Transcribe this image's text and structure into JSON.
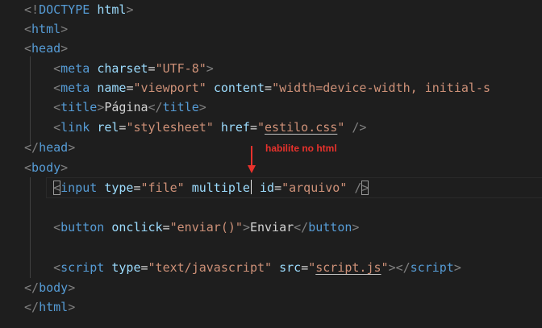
{
  "colors": {
    "bracket": "#808080",
    "tag": "#569cd6",
    "attr": "#9cdcfe",
    "string": "#ce9178",
    "text": "#d4d4d4",
    "annotation": "#e8322c"
  },
  "lines": [
    [
      {
        "t": "<!",
        "c": "bracket"
      },
      {
        "t": "DOCTYPE",
        "c": "tag"
      },
      {
        "t": " ",
        "c": "text"
      },
      {
        "t": "html",
        "c": "attr"
      },
      {
        "t": ">",
        "c": "bracket"
      }
    ],
    [
      {
        "t": "<",
        "c": "bracket"
      },
      {
        "t": "html",
        "c": "tag"
      },
      {
        "t": ">",
        "c": "bracket"
      }
    ],
    [
      {
        "t": "<",
        "c": "bracket"
      },
      {
        "t": "head",
        "c": "tag"
      },
      {
        "t": ">",
        "c": "bracket"
      }
    ],
    [
      {
        "t": "    ",
        "c": "text"
      },
      {
        "t": "<",
        "c": "bracket"
      },
      {
        "t": "meta",
        "c": "tag"
      },
      {
        "t": " ",
        "c": "text"
      },
      {
        "t": "charset",
        "c": "attr"
      },
      {
        "t": "=",
        "c": "text"
      },
      {
        "t": "\"UTF-8\"",
        "c": "string"
      },
      {
        "t": ">",
        "c": "bracket"
      }
    ],
    [
      {
        "t": "    ",
        "c": "text"
      },
      {
        "t": "<",
        "c": "bracket"
      },
      {
        "t": "meta",
        "c": "tag"
      },
      {
        "t": " ",
        "c": "text"
      },
      {
        "t": "name",
        "c": "attr"
      },
      {
        "t": "=",
        "c": "text"
      },
      {
        "t": "\"viewport\"",
        "c": "string"
      },
      {
        "t": " ",
        "c": "text"
      },
      {
        "t": "content",
        "c": "attr"
      },
      {
        "t": "=",
        "c": "text"
      },
      {
        "t": "\"width=device-width, initial-s",
        "c": "string"
      }
    ],
    [
      {
        "t": "    ",
        "c": "text"
      },
      {
        "t": "<",
        "c": "bracket"
      },
      {
        "t": "title",
        "c": "tag"
      },
      {
        "t": ">",
        "c": "bracket"
      },
      {
        "t": "Página",
        "c": "text"
      },
      {
        "t": "</",
        "c": "bracket"
      },
      {
        "t": "title",
        "c": "tag"
      },
      {
        "t": ">",
        "c": "bracket"
      }
    ],
    [
      {
        "t": "    ",
        "c": "text"
      },
      {
        "t": "<",
        "c": "bracket"
      },
      {
        "t": "link",
        "c": "tag"
      },
      {
        "t": " ",
        "c": "text"
      },
      {
        "t": "rel",
        "c": "attr"
      },
      {
        "t": "=",
        "c": "text"
      },
      {
        "t": "\"stylesheet\"",
        "c": "string"
      },
      {
        "t": " ",
        "c": "text"
      },
      {
        "t": "href",
        "c": "attr"
      },
      {
        "t": "=",
        "c": "text"
      },
      {
        "t": "\"",
        "c": "string"
      },
      {
        "t": "estilo.css",
        "c": "string",
        "u": true
      },
      {
        "t": "\"",
        "c": "string"
      },
      {
        "t": " ",
        "c": "text"
      },
      {
        "t": "/>",
        "c": "bracket"
      }
    ],
    [
      {
        "t": "</",
        "c": "bracket"
      },
      {
        "t": "head",
        "c": "tag"
      },
      {
        "t": ">",
        "c": "bracket"
      }
    ],
    [
      {
        "t": "<",
        "c": "bracket"
      },
      {
        "t": "body",
        "c": "tag"
      },
      {
        "t": ">",
        "c": "bracket"
      }
    ],
    [
      {
        "t": "    ",
        "c": "text"
      },
      {
        "t": "<",
        "c": "bracket",
        "box": true
      },
      {
        "t": "input",
        "c": "tag"
      },
      {
        "t": " ",
        "c": "text"
      },
      {
        "t": "type",
        "c": "attr"
      },
      {
        "t": "=",
        "c": "text"
      },
      {
        "t": "\"file\"",
        "c": "string"
      },
      {
        "t": " ",
        "c": "text"
      },
      {
        "t": "multiple",
        "c": "attr",
        "caret": true
      },
      {
        "t": " ",
        "c": "text"
      },
      {
        "t": "id",
        "c": "attr"
      },
      {
        "t": "=",
        "c": "text"
      },
      {
        "t": "\"arquivo\"",
        "c": "string"
      },
      {
        "t": " ",
        "c": "text"
      },
      {
        "t": "/",
        "c": "bracket"
      },
      {
        "t": ">",
        "c": "bracket",
        "box": true
      }
    ],
    [],
    [
      {
        "t": "    ",
        "c": "text"
      },
      {
        "t": "<",
        "c": "bracket"
      },
      {
        "t": "button",
        "c": "tag"
      },
      {
        "t": " ",
        "c": "text"
      },
      {
        "t": "onclick",
        "c": "attr"
      },
      {
        "t": "=",
        "c": "text"
      },
      {
        "t": "\"enviar()\"",
        "c": "string"
      },
      {
        "t": ">",
        "c": "bracket"
      },
      {
        "t": "Enviar",
        "c": "text"
      },
      {
        "t": "</",
        "c": "bracket"
      },
      {
        "t": "button",
        "c": "tag"
      },
      {
        "t": ">",
        "c": "bracket"
      }
    ],
    [],
    [
      {
        "t": "    ",
        "c": "text"
      },
      {
        "t": "<",
        "c": "bracket"
      },
      {
        "t": "script",
        "c": "tag"
      },
      {
        "t": " ",
        "c": "text"
      },
      {
        "t": "type",
        "c": "attr"
      },
      {
        "t": "=",
        "c": "text"
      },
      {
        "t": "\"text/javascript\"",
        "c": "string"
      },
      {
        "t": " ",
        "c": "text"
      },
      {
        "t": "src",
        "c": "attr"
      },
      {
        "t": "=",
        "c": "text"
      },
      {
        "t": "\"",
        "c": "string"
      },
      {
        "t": "script.js",
        "c": "string",
        "u": true
      },
      {
        "t": "\"",
        "c": "string"
      },
      {
        "t": ">",
        "c": "bracket"
      },
      {
        "t": "</",
        "c": "bracket"
      },
      {
        "t": "script",
        "c": "tag"
      },
      {
        "t": ">",
        "c": "bracket"
      }
    ],
    [
      {
        "t": "</",
        "c": "bracket"
      },
      {
        "t": "body",
        "c": "tag"
      },
      {
        "t": ">",
        "c": "bracket"
      }
    ],
    [
      {
        "t": "</",
        "c": "bracket"
      },
      {
        "t": "html",
        "c": "tag"
      },
      {
        "t": ">",
        "c": "bracket"
      }
    ]
  ],
  "annotation": {
    "text": "habilite no html"
  }
}
